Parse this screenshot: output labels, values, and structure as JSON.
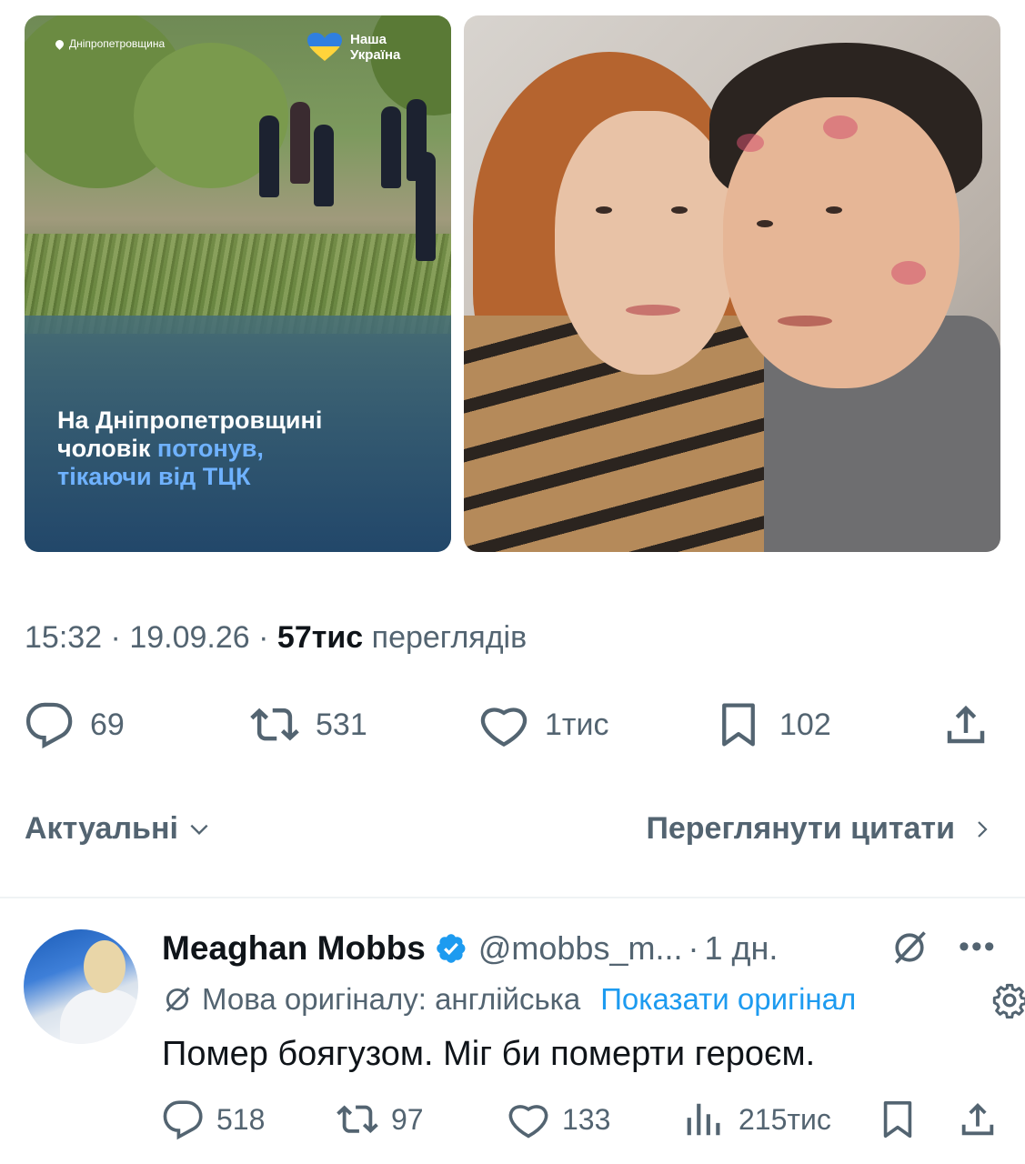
{
  "news_image": {
    "location": "Дніпропетровщина",
    "brand_line1": "Наша",
    "brand_line2": "Україна",
    "headline_line1": "На Дніпропетровщині",
    "headline_line2_a": "чоловік ",
    "headline_line2_b": "потонув,",
    "headline_line3": "тікаючи від ТЦК"
  },
  "tweet_meta": {
    "time": "15:32",
    "date": "19.09.26",
    "views_value": "57тис",
    "views_label": "переглядів",
    "separator": "·"
  },
  "actions": {
    "replies": "69",
    "reposts": "531",
    "likes": "1тис",
    "bookmarks": "102"
  },
  "sort": {
    "label": "Актуальні",
    "quotes_label": "Переглянути цитати"
  },
  "reply": {
    "author": "Meaghan Mobbs",
    "handle": "@mobbs_m...",
    "age": "1 дн.",
    "translation_note": "Мова оригіналу: англійська",
    "show_original": "Показати оригінал",
    "text": "Помер боягузом. Міг би померти героєм.",
    "replies": "518",
    "reposts": "97",
    "likes": "133",
    "views": "215тис"
  },
  "colors": {
    "text_primary": "#0f1419",
    "text_secondary": "#536471",
    "link": "#1d9bf0",
    "verified": "#1d9bf0"
  },
  "icons": [
    "location-pin-icon",
    "ukraine-heart-icon",
    "reply-icon",
    "repost-icon",
    "like-icon",
    "bookmark-icon",
    "share-icon",
    "chevron-down-icon",
    "chevron-right-icon",
    "verified-badge-icon",
    "grok-icon",
    "more-icon",
    "translate-icon",
    "settings-icon",
    "views-icon"
  ]
}
